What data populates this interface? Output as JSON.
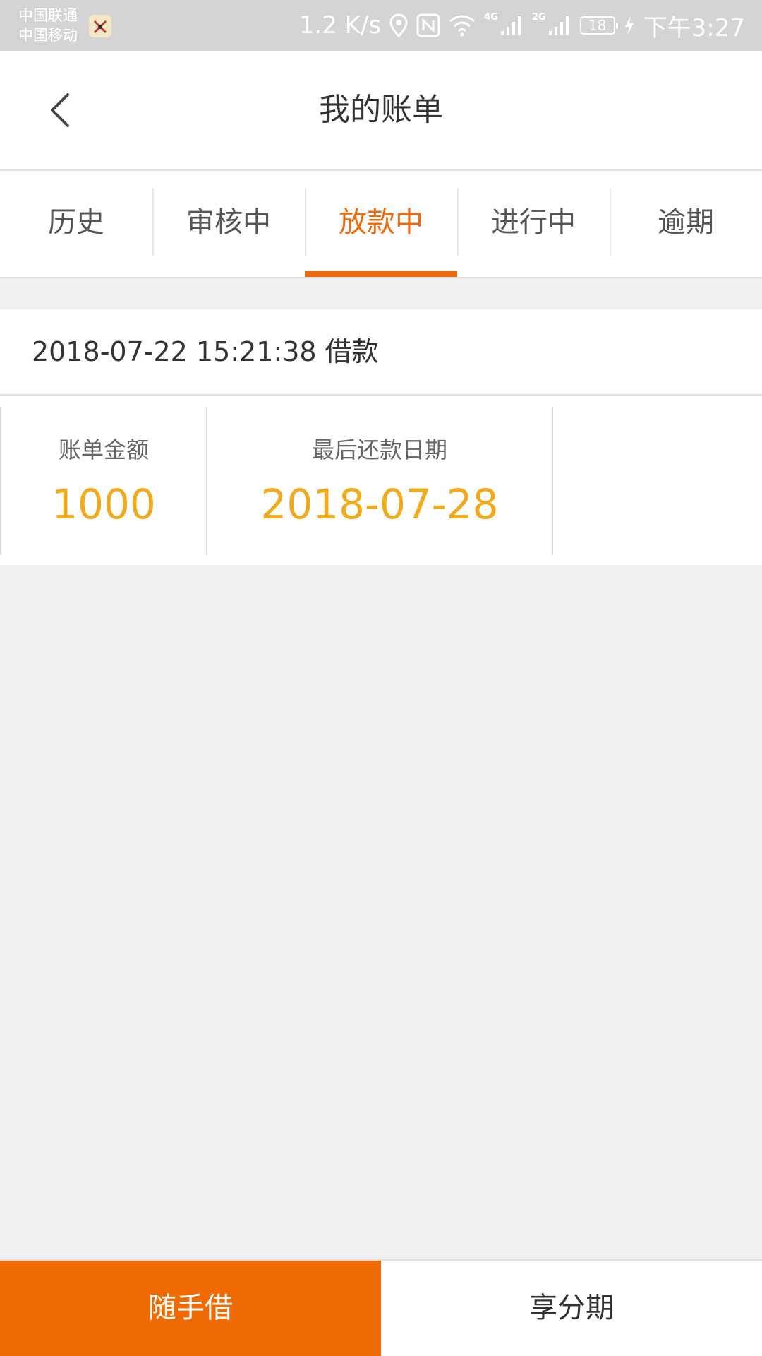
{
  "status_bar": {
    "carrier_1": "中国联通",
    "carrier_2": "中国移动",
    "net_speed": "1.2 K/s",
    "signal_1_label": "4G",
    "signal_2_label": "2G",
    "battery": "18",
    "time": "下午3:27"
  },
  "header": {
    "title": "我的账单"
  },
  "tabs": [
    {
      "label": "历史"
    },
    {
      "label": "审核中"
    },
    {
      "label": "放款中"
    },
    {
      "label": "进行中"
    },
    {
      "label": "逾期"
    }
  ],
  "active_tab": "放款中",
  "bill": {
    "header": "2018-07-22 15:21:38 借款",
    "amount_label": "账单金额",
    "amount": "1000",
    "due_label": "最后还款日期",
    "due_date": "2018-07-28"
  },
  "bottom_bar": {
    "borrow_label": "随手借",
    "installment_label": "享分期"
  },
  "colors": {
    "accent": "#ee6a0c",
    "value": "#f0aa1c",
    "status_bar": "#d4d4d4"
  }
}
